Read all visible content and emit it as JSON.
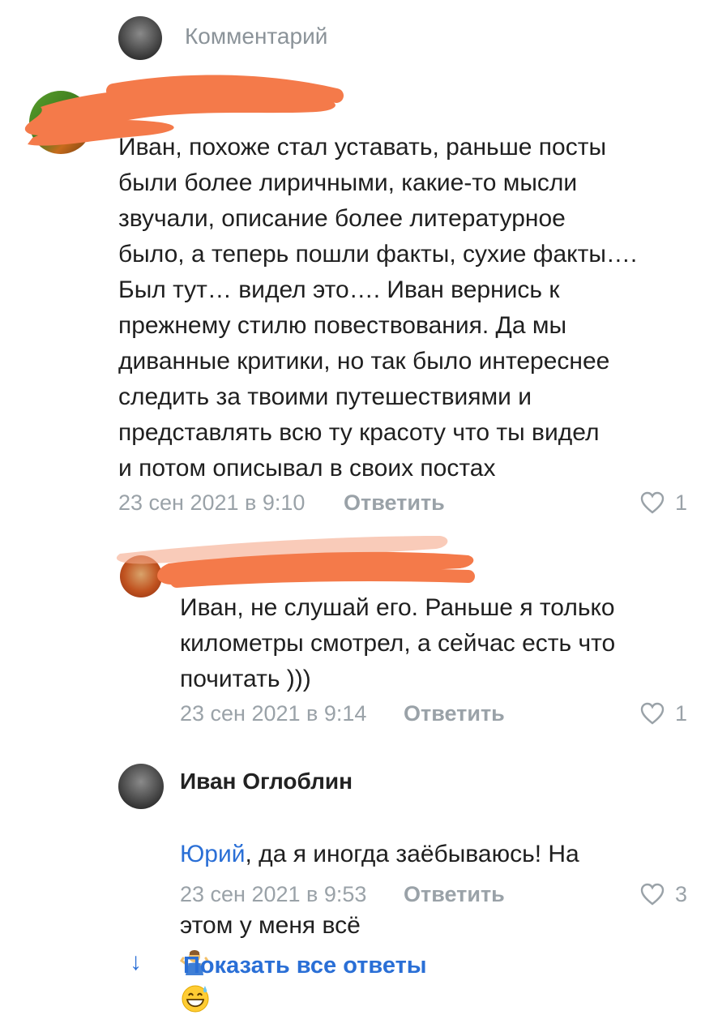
{
  "composer": {
    "placeholder": "Комментарий"
  },
  "comments": [
    {
      "author": "",
      "text": "Иван, похоже стал уставать, раньше посты\nбыли более лиричными, какие-то мысли\nзвучали, описание более литературное\nбыло, а теперь пошли факты, сухие факты….\nБыл тут… видел это….  Иван вернись к\nпрежнему стилю повествования. Да мы\nдиванные критики, но так было интереснее\nследить за твоими путешествиями и\nпредставлять всю ту красоту что ты видел\nи потом описывал в своих постах",
      "date": "23 сен 2021 в 9:10",
      "reply_label": "Ответить",
      "likes": "1"
    },
    {
      "author": "",
      "text": "Иван, не слушай его. Раньше я только\nкилометры смотрел, а сейчас есть что\nпочитать )))",
      "date": "23 сен 2021 в 9:14",
      "reply_label": "Ответить",
      "likes": "1"
    },
    {
      "author": "Иван Оглоблин",
      "mention": "Юрий",
      "text_line1_rest": ", да я иногда заёбываюсь! На",
      "text_line2": "этом у меня всё",
      "emojis": [
        "person-shrugging-emoji",
        "grinning-sweat-emoji"
      ],
      "date": "23 сен 2021 в 9:53",
      "reply_label": "Ответить",
      "likes": "3"
    }
  ],
  "show_all": {
    "arrow": "↓",
    "label": "Показать все ответы"
  },
  "colors": {
    "meta": "#9aa2a8",
    "link": "#2a6fd6",
    "redaction": "#f47a4a"
  }
}
